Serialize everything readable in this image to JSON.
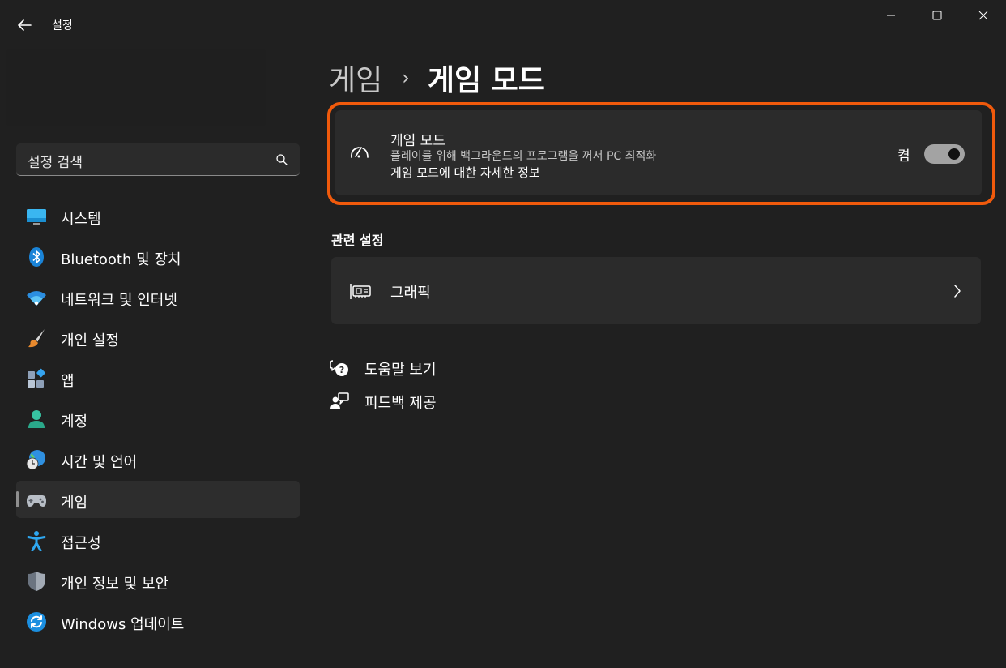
{
  "window": {
    "title": "설정",
    "controls": {
      "minimize": "minimize-icon",
      "maximize": "maximize-icon",
      "close": "close-icon"
    }
  },
  "search": {
    "placeholder": "설정 검색"
  },
  "sidebar": {
    "items": [
      {
        "label": "시스템",
        "icon": "system-monitor-icon",
        "selected": false
      },
      {
        "label": "Bluetooth 및 장치",
        "icon": "bluetooth-icon",
        "selected": false
      },
      {
        "label": "네트워크 및 인터넷",
        "icon": "wifi-icon",
        "selected": false
      },
      {
        "label": "개인 설정",
        "icon": "paintbrush-icon",
        "selected": false
      },
      {
        "label": "앱",
        "icon": "apps-icon",
        "selected": false
      },
      {
        "label": "계정",
        "icon": "account-icon",
        "selected": false
      },
      {
        "label": "시간 및 언어",
        "icon": "globe-clock-icon",
        "selected": false
      },
      {
        "label": "게임",
        "icon": "gamepad-icon",
        "selected": true
      },
      {
        "label": "접근성",
        "icon": "accessibility-icon",
        "selected": false
      },
      {
        "label": "개인 정보 및 보안",
        "icon": "shield-icon",
        "selected": false
      },
      {
        "label": "Windows 업데이트",
        "icon": "update-icon",
        "selected": false
      }
    ]
  },
  "breadcrumb": {
    "parent": "게임",
    "separator": "›",
    "current": "게임 모드"
  },
  "game_mode": {
    "title": "게임 모드",
    "description": "플레이를 위해 백그라운드의 프로그램을 꺼서 PC 최적화",
    "link": "게임 모드에 대한 자세한 정보",
    "state_label": "켬",
    "enabled": true,
    "highlight_color": "#f05a0c"
  },
  "related": {
    "heading": "관련 설정",
    "items": [
      {
        "label": "그래픽",
        "icon": "graphics-card-icon"
      }
    ]
  },
  "help_links": {
    "help": "도움말 보기",
    "feedback": "피드백 제공"
  },
  "colors": {
    "background": "#202020",
    "card": "#2b2b2b",
    "accent_highlight": "#f05a0c",
    "toggle_on": "#a3a3a3"
  }
}
